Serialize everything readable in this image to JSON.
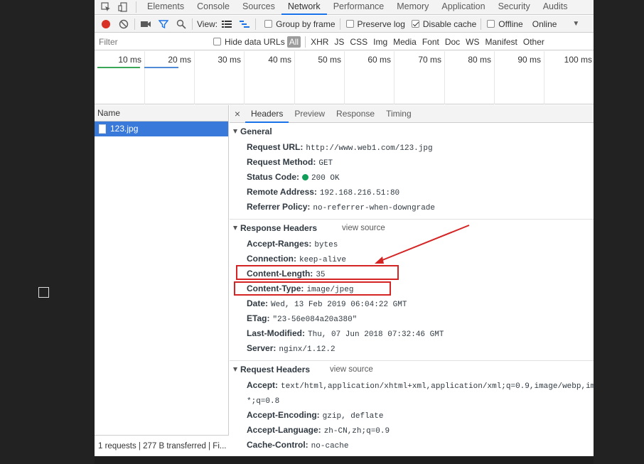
{
  "tabs": [
    "Elements",
    "Console",
    "Sources",
    "Network",
    "Performance",
    "Memory",
    "Application",
    "Security",
    "Audits"
  ],
  "active_tab": "Network",
  "toolbar": {
    "view_label": "View:",
    "group_by_frame": "Group by frame",
    "preserve_log": "Preserve log",
    "disable_cache": "Disable cache",
    "offline": "Offline",
    "throttle": "Online",
    "disable_cache_checked": true
  },
  "filter": {
    "placeholder": "Filter",
    "hide_data_urls": "Hide data URLs",
    "types": [
      "All",
      "XHR",
      "JS",
      "CSS",
      "Img",
      "Media",
      "Font",
      "Doc",
      "WS",
      "Manifest",
      "Other"
    ]
  },
  "timeline": {
    "labels": [
      "10 ms",
      "20 ms",
      "30 ms",
      "40 ms",
      "50 ms",
      "60 ms",
      "70 ms",
      "80 ms",
      "90 ms",
      "100 ms"
    ]
  },
  "list": {
    "header": "Name",
    "items": [
      {
        "name": "123.jpg"
      }
    ],
    "status": "1 requests | 277 B transferred | Fi..."
  },
  "detail": {
    "tabs": [
      "Headers",
      "Preview",
      "Response",
      "Timing"
    ],
    "active": "Headers",
    "close": "×",
    "view_source": "view source",
    "general": {
      "title": "General",
      "rows": [
        {
          "name": "Request URL:",
          "value": "http://www.web1.com/123.jpg"
        },
        {
          "name": "Request Method:",
          "value": "GET"
        },
        {
          "name": "Status Code:",
          "value": "200 OK"
        },
        {
          "name": "Remote Address:",
          "value": "192.168.216.51:80"
        },
        {
          "name": "Referrer Policy:",
          "value": "no-referrer-when-downgrade"
        }
      ]
    },
    "response": {
      "title": "Response Headers",
      "rows": [
        {
          "name": "Accept-Ranges:",
          "value": "bytes"
        },
        {
          "name": "Connection:",
          "value": "keep-alive"
        },
        {
          "name": "Content-Length:",
          "value": "35"
        },
        {
          "name": "Content-Type:",
          "value": "image/jpeg"
        },
        {
          "name": "Date:",
          "value": "Wed, 13 Feb 2019 06:04:22 GMT"
        },
        {
          "name": "ETag:",
          "value": "\"23-56e084a20a380\""
        },
        {
          "name": "Last-Modified:",
          "value": "Thu, 07 Jun 2018 07:32:46 GMT"
        },
        {
          "name": "Server:",
          "value": "nginx/1.12.2"
        }
      ]
    },
    "request": {
      "title": "Request Headers",
      "rows": [
        {
          "name": "Accept:",
          "value": "text/html,application/xhtml+xml,application/xml;q=0.9,image/webp,image/apng,*/"
        },
        {
          "name": "",
          "value": "*;q=0.8"
        },
        {
          "name": "Accept-Encoding:",
          "value": "gzip, deflate"
        },
        {
          "name": "Accept-Language:",
          "value": "zh-CN,zh;q=0.9"
        },
        {
          "name": "Cache-Control:",
          "value": "no-cache"
        }
      ]
    }
  },
  "annotation_color": "#d42424"
}
